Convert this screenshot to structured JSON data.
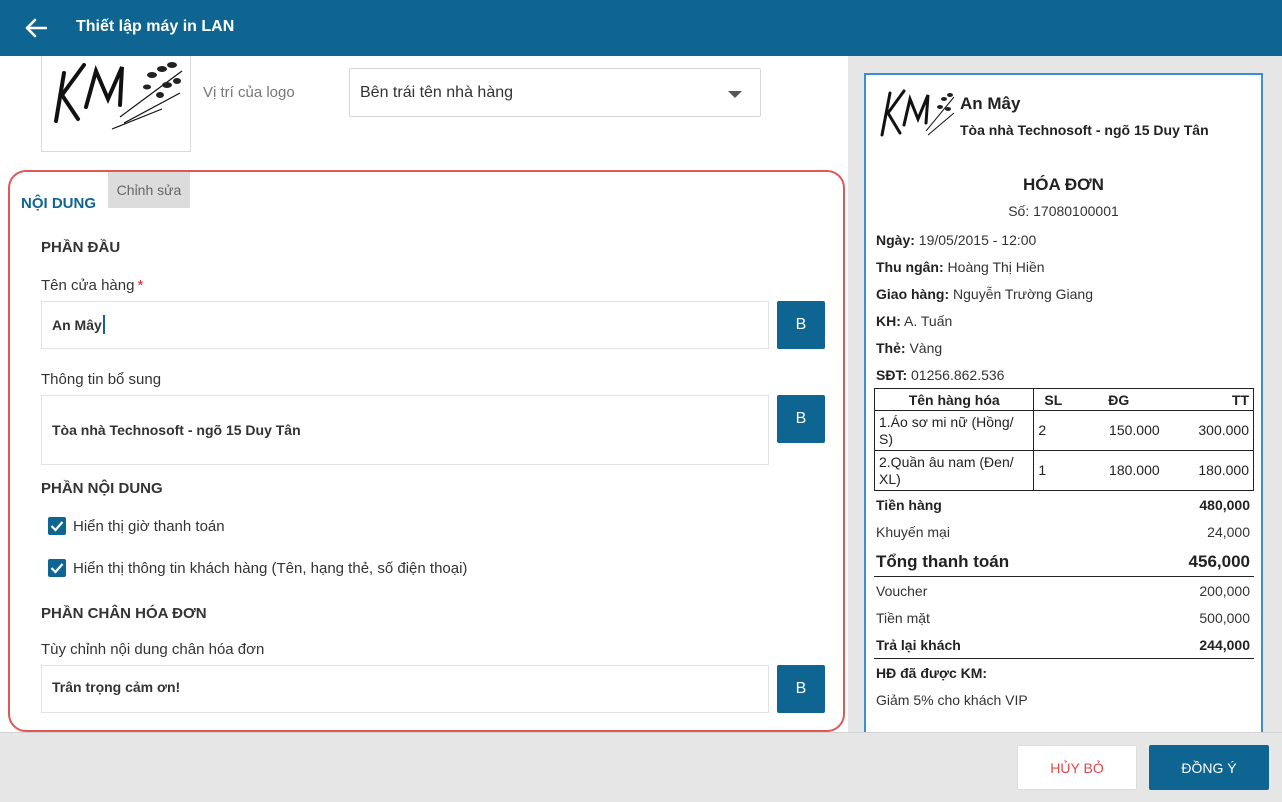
{
  "header": {
    "title": "Thiết lập máy in LAN"
  },
  "logo": {
    "edit_label": "Chỉnh sửa",
    "position_label": "Vị trí của logo",
    "position_value": "Bên trái tên nhà hàng"
  },
  "content": {
    "section_title": "NỘI DUNG",
    "head_title": "PHẦN ĐẦU",
    "store_name_label": "Tên cửa hàng",
    "required_mark": "*",
    "store_name_value": "An Mây",
    "extra_info_label": "Thông tin bổ sung",
    "extra_info_value": "Tòa nhà Technosoft - ngõ 15 Duy Tân",
    "body_title": "PHẦN NỘI DUNG",
    "check_payment_time": "Hiển thị giờ thanh toán",
    "check_customer_info": "Hiển thị thông tin khách hàng (Tên, hạng thẻ, số điện thoại)",
    "footer_title": "PHẦN CHÂN HÓA ĐƠN",
    "footer_label": "Tùy chỉnh nội dung chân hóa đơn",
    "footer_value": "Trân trọng cảm ơn!",
    "bold_label": "B"
  },
  "receipt": {
    "store": "An Mây",
    "address": "Tòa nhà Technosoft - ngõ 15 Duy Tân",
    "title": "HÓA ĐƠN",
    "number": "Số: 17080100001",
    "info": [
      {
        "label": "Ngày:",
        "value": "19/05/2015 - 12:00"
      },
      {
        "label": "Thu ngân:",
        "value": "Hoàng Thị Hiền"
      },
      {
        "label": "Giao hàng:",
        "value": "Nguyễn Trường Giang"
      },
      {
        "label": "KH:",
        "value": "A. Tuấn"
      },
      {
        "label": "Thẻ:",
        "value": "Vàng"
      },
      {
        "label": "SĐT:",
        "value": "01256.862.536"
      }
    ],
    "table_headers": [
      "Tên hàng hóa",
      "SL",
      "ĐG",
      "TT"
    ],
    "items": [
      {
        "name": "1.Áo sơ mi nữ (Hồng/ S)",
        "qty": "2",
        "price": "150.000",
        "total": "300.000"
      },
      {
        "name": "2.Quần âu nam (Đen/ XL)",
        "qty": "1",
        "price": "180.000",
        "total": "180.000"
      }
    ],
    "subtotal_label": "Tiền hàng",
    "subtotal_value": "480,000",
    "discount_label": "Khuyến mại",
    "discount_value": "24,000",
    "grand_label": "Tổng thanh toán",
    "grand_value": "456,000",
    "voucher_label": "Voucher",
    "voucher_value": "200,000",
    "cash_label": "Tiền mặt",
    "cash_value": "500,000",
    "change_label": "Trả lại khách",
    "change_value": "244,000",
    "promo_title": "HĐ đã được KM:",
    "promo_desc": "Giảm 5% cho khách VIP"
  },
  "footer": {
    "cancel_label": "HỦY BỎ",
    "ok_label": "ĐỒNG Ý"
  },
  "colors": {
    "primary": "#0f6592",
    "highlight_border": "#e05757",
    "cancel_text": "#e04848",
    "receipt_border": "#3a8fd6"
  }
}
